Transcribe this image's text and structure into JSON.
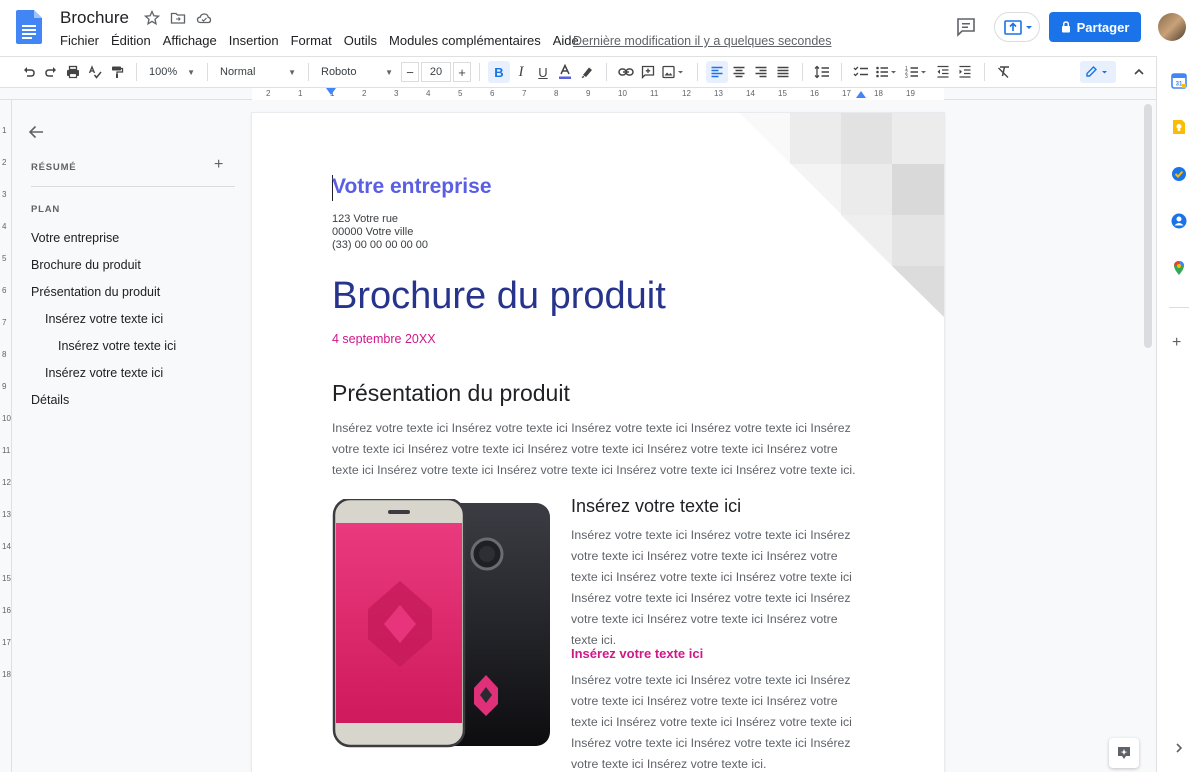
{
  "header": {
    "title": "Brochure",
    "menu": [
      "Fichier",
      "Édition",
      "Affichage",
      "Insertion",
      "Format",
      "Outils",
      "Modules complémentaires",
      "Aide"
    ],
    "last_edit": "Dernière modification il y a quelques secondes",
    "share_label": "Partager",
    "icons": [
      "docs-logo-icon",
      "star-icon",
      "move-folder-icon",
      "cloud-saved-icon",
      "comment-history-icon",
      "present-icon",
      "lock-icon",
      "avatar"
    ]
  },
  "toolbar": {
    "zoom": "100%",
    "style": "Normal",
    "font": "Roboto",
    "font_size": "20",
    "minus": "−",
    "plus": "+",
    "icons": [
      "undo-icon",
      "redo-icon",
      "print-icon",
      "spellcheck-icon",
      "paint-format-icon",
      "bold-icon",
      "italic-icon",
      "underline-icon",
      "text-color-icon",
      "highlight-icon",
      "link-icon",
      "add-comment-icon",
      "insert-image-icon",
      "align-left-icon",
      "align-center-icon",
      "align-right-icon",
      "justify-icon",
      "line-spacing-icon",
      "checklist-icon",
      "bulleted-list-icon",
      "numbered-list-icon",
      "decrease-indent-icon",
      "increase-indent-icon",
      "clear-formatting-icon",
      "editing-mode-icon",
      "collapse-icon"
    ],
    "accent_color": "#1a73e8"
  },
  "ruler": {
    "labels": [
      "2",
      "1",
      "1",
      "2",
      "3",
      "4",
      "5",
      "6",
      "7",
      "8",
      "9",
      "10",
      "11",
      "12",
      "13",
      "14",
      "15",
      "16",
      "17",
      "18",
      "19"
    ],
    "vlabels": [
      "1",
      "2",
      "3",
      "4",
      "5",
      "6",
      "7",
      "8",
      "9",
      "10",
      "11",
      "12",
      "13",
      "14",
      "15",
      "16",
      "17",
      "18"
    ]
  },
  "outline": {
    "summary_label": "RÉSUMÉ",
    "add_label": "+",
    "plan_label": "PLAN",
    "items": [
      {
        "label": "Votre entreprise",
        "level": 1
      },
      {
        "label": "Brochure du produit",
        "level": 1
      },
      {
        "label": "Présentation du produit",
        "level": 1
      },
      {
        "label": "Insérez votre texte ici",
        "level": 2
      },
      {
        "label": "Insérez votre texte ici",
        "level": 3
      },
      {
        "label": "Insérez votre texte ici",
        "level": 2
      },
      {
        "label": "Détails",
        "level": 1
      }
    ]
  },
  "document": {
    "company": "Votre entreprise",
    "address": [
      "123 Votre rue",
      "00000 Votre ville",
      "(33) 00 00 00 00 00"
    ],
    "title": "Brochure du produit",
    "date": "4 septembre 20XX",
    "section_heading": "Présentation du produit",
    "section_body": "Insérez votre texte ici Insérez votre texte ici Insérez votre texte ici Insérez votre texte ici Insérez votre texte ici Insérez votre texte ici Insérez votre texte ici Insérez votre texte ici Insérez votre texte ici Insérez votre texte ici Insérez votre texte ici Insérez votre texte ici Insérez votre texte ici.",
    "sub_heading": "Insérez votre texte ici",
    "sub_body": "Insérez votre texte ici Insérez votre texte ici Insérez votre texte ici Insérez votre texte ici Insérez votre texte ici Insérez votre texte ici Insérez votre texte ici Insérez votre texte ici Insérez votre texte ici Insérez votre texte ici Insérez votre texte ici Insérez votre texte ici.",
    "sub_heading2": "Insérez votre texte ici",
    "sub_body2": "Insérez votre texte ici Insérez votre texte ici Insérez votre texte ici Insérez votre texte ici Insérez votre texte ici Insérez votre texte ici Insérez votre texte ici Insérez votre texte ici Insérez votre texte ici Insérez votre texte ici Insérez votre texte ici.",
    "colors": {
      "company": "#5a5ee3",
      "title": "#27348b",
      "accent": "#d0178a",
      "phone_screen": "#e3276f"
    }
  },
  "side_panel": {
    "icons": [
      "calendar-icon",
      "keep-icon",
      "tasks-icon",
      "contacts-icon",
      "maps-icon",
      "add-addon-icon",
      "show-side-panel-icon"
    ]
  }
}
